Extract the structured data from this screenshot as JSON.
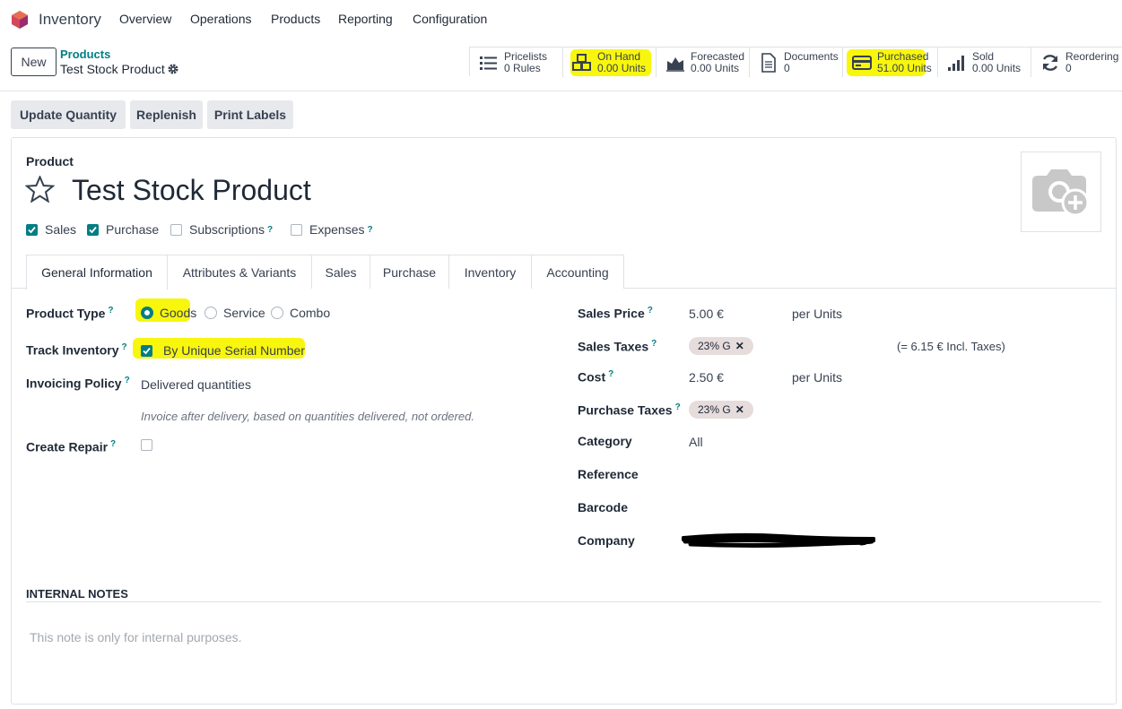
{
  "navbar": {
    "app_name": "Inventory",
    "menu": [
      "Overview",
      "Operations",
      "Products",
      "Reporting",
      "Configuration"
    ]
  },
  "control_panel": {
    "new_button": "New",
    "breadcrumb_parent": "Products",
    "breadcrumb_current": "Test Stock Product"
  },
  "smart_buttons": [
    {
      "label": "Pricelists",
      "value": "0 Rules",
      "icon": "list-icon"
    },
    {
      "label": "On Hand",
      "value": "0.00 Units",
      "icon": "cubes-icon"
    },
    {
      "label": "Forecasted",
      "value": "0.00 Units",
      "icon": "area-chart-icon"
    },
    {
      "label": "Documents",
      "value": "0",
      "icon": "document-icon"
    },
    {
      "label": "Purchased",
      "value": "51.00 Units",
      "icon": "credit-card-icon"
    },
    {
      "label": "Sold",
      "value": "0.00 Units",
      "icon": "signal-icon"
    },
    {
      "label": "Reordering R",
      "value": "0",
      "icon": "refresh-icon"
    }
  ],
  "actions": [
    "Update Quantity",
    "Replenish",
    "Print Labels"
  ],
  "form": {
    "product_label": "Product",
    "product_name": "Test Stock Product",
    "flags": [
      {
        "label": "Sales",
        "checked": true,
        "help": false
      },
      {
        "label": "Purchase",
        "checked": true,
        "help": false
      },
      {
        "label": "Subscriptions",
        "checked": false,
        "help": true
      },
      {
        "label": "Expenses",
        "checked": false,
        "help": true
      }
    ],
    "tabs": [
      "General Information",
      "Attributes & Variants",
      "Sales",
      "Purchase",
      "Inventory",
      "Accounting"
    ],
    "help_mark": "?",
    "left": {
      "product_type_label": "Product Type",
      "product_type_options": [
        "Goods",
        "Service",
        "Combo"
      ],
      "product_type_selected": "Goods",
      "track_inventory_label": "Track Inventory",
      "track_inventory_value": "By Unique Serial Number",
      "invoicing_policy_label": "Invoicing Policy",
      "invoicing_policy_value": "Delivered quantities",
      "invoicing_help": "Invoice after delivery, based on quantities delivered, not ordered.",
      "create_repair_label": "Create Repair"
    },
    "right": {
      "sales_price_label": "Sales Price",
      "sales_price_value": "5.00 €",
      "per_units_1": "per Units",
      "sales_taxes_label": "Sales Taxes",
      "sales_taxes_tag": "23% G",
      "incl_taxes": "(= 6.15 € Incl. Taxes)",
      "cost_label": "Cost",
      "cost_value": "2.50 €",
      "per_units_2": "per Units",
      "purchase_taxes_label": "Purchase Taxes",
      "purchase_taxes_tag": "23% G",
      "category_label": "Category",
      "category_value": "All",
      "reference_label": "Reference",
      "barcode_label": "Barcode",
      "company_label": "Company"
    },
    "notes_title": "INTERNAL NOTES",
    "notes_placeholder": "This note is only for internal purposes."
  },
  "colors": {
    "accent": "#017e84",
    "brand": "#714b67",
    "highlight": "#f8f500"
  }
}
